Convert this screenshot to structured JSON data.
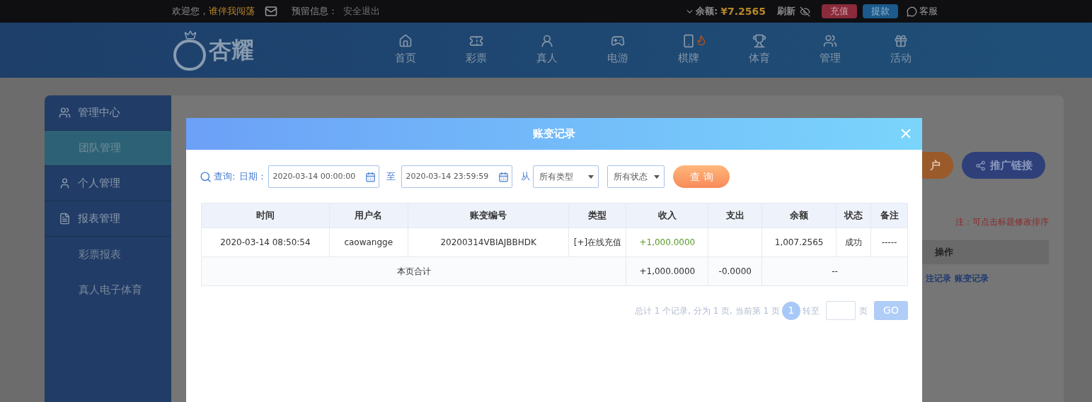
{
  "top_bar": {
    "greeting": "欢迎您，",
    "username": "谁伴我闯荡",
    "reserved_info": "预留信息：",
    "logout": "安全退出",
    "balance_label": "余额:",
    "balance": "¥7.2565",
    "refresh": "刷新",
    "deposit": "充值",
    "withdraw": "提款",
    "service": "客服"
  },
  "header": {
    "logo": "杏耀",
    "nav": [
      {
        "label": "首页",
        "kind": "home"
      },
      {
        "label": "彩票",
        "kind": "ticket"
      },
      {
        "label": "真人",
        "kind": "person"
      },
      {
        "label": "电游",
        "kind": "slot"
      },
      {
        "label": "棋牌",
        "kind": "cards"
      },
      {
        "label": "体育",
        "kind": "trophy"
      },
      {
        "label": "管理",
        "kind": "users"
      },
      {
        "label": "活动",
        "kind": "gift"
      }
    ]
  },
  "sidebar": {
    "items": [
      {
        "label": "管理中心",
        "kind": "users",
        "selected": false,
        "children": [
          {
            "label": "团队管理",
            "selected": true
          }
        ]
      },
      {
        "label": "个人管理",
        "kind": "user",
        "selected": false
      },
      {
        "label": "报表管理",
        "kind": "report",
        "selected": false,
        "children": [
          {
            "label": "彩票报表",
            "selected": false
          },
          {
            "label": "真人电子体育",
            "selected": false
          }
        ]
      }
    ]
  },
  "page": {
    "buttons": [
      "户",
      "推广链接"
    ],
    "note": "注：可点击标题修改排序",
    "column": "操作",
    "links": [
      "注记录",
      "账变记录"
    ]
  },
  "modal": {
    "title": "账变记录",
    "filter": {
      "query_label": "查询:",
      "date_label": "日期：",
      "start": "2020-03-14 00:00:00",
      "to": "至",
      "end": "2020-03-14 23:59:59",
      "from": "从",
      "type_select": "所有类型",
      "status_select": "所有状态",
      "button": "查 询"
    },
    "table": {
      "columns": [
        "时间",
        "用户名",
        "账变编号",
        "类型",
        "收入",
        "支出",
        "余额",
        "状态",
        "备注"
      ],
      "rows": [
        [
          "2020-03-14 08:50:54",
          "caowangge",
          "20200314VBIAJBBHDK",
          "[+]在线充值",
          "+1,000.0000",
          "",
          "1,007.2565",
          "成功",
          "-----"
        ]
      ],
      "total": {
        "label": "本页合计",
        "income": "+1,000.0000",
        "expense": "-0.0000",
        "balance": "--"
      }
    },
    "pagination": {
      "summary": "总计 1 个记录, 分为 1 页, 当前第 1 页",
      "pages": [
        {
          "label": "1",
          "selected": true
        }
      ],
      "goto": "转至",
      "page_unit": "页",
      "go": "GO"
    }
  }
}
